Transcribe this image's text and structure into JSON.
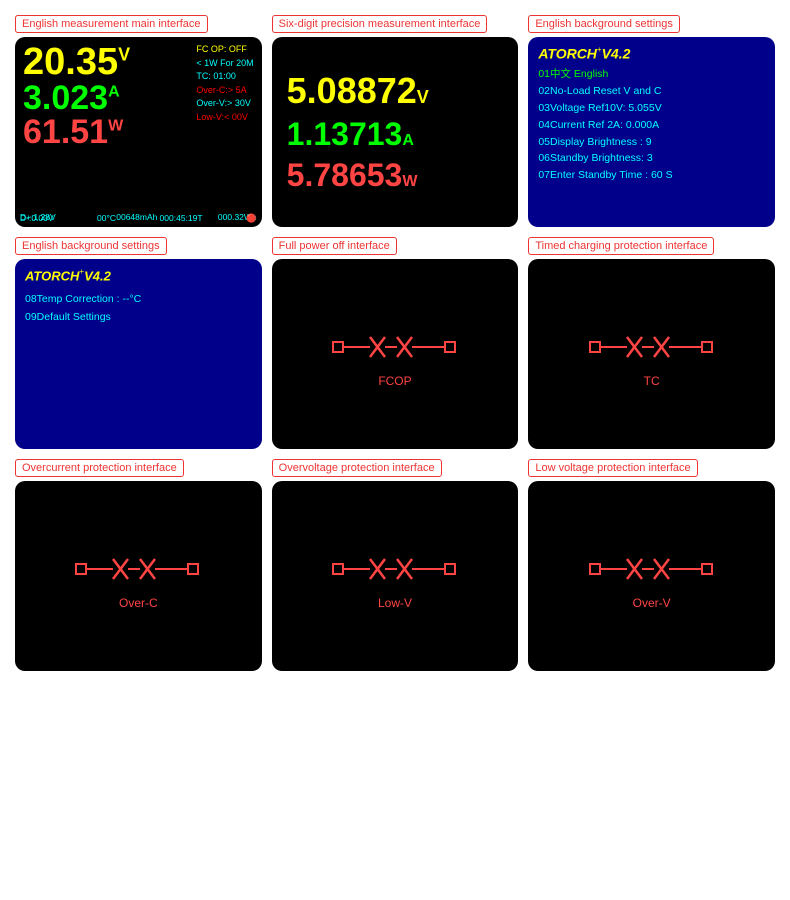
{
  "cells": [
    {
      "label": "English measurement main interface",
      "type": "main"
    },
    {
      "label": "Six-digit precision measurement interface",
      "type": "six"
    },
    {
      "label": "English background settings",
      "type": "bg1"
    },
    {
      "label": "English background settings",
      "type": "bg2"
    },
    {
      "label": "Full power off interface",
      "type": "fcop"
    },
    {
      "label": "Timed charging protection interface",
      "type": "tc"
    },
    {
      "label": "Overcurrent protection interface",
      "type": "overc"
    },
    {
      "label": "Overvoltage protection interface",
      "type": "lowv"
    },
    {
      "label": "Low voltage protection interface",
      "type": "overv"
    }
  ],
  "main": {
    "voltage": "20.35",
    "voltage_unit": "V",
    "current": "3.023",
    "current_unit": "A",
    "power": "61.51",
    "power_unit": "W",
    "fc": "FC OP: OFF",
    "lt1w": "< 1W For 20M",
    "tc": "TC:    01:00",
    "oc": "Over-C:> 5A",
    "ov": "Over-V:> 30V",
    "lv": "Low-V:< 00V",
    "d_pos": "D+:1.28V",
    "mah": "00648mAh",
    "wh": "000.32Wh",
    "d_neg": "D-:0.00V",
    "temp": "00°C",
    "time": "000:45:19T"
  },
  "six": {
    "voltage": "5.08872",
    "voltage_unit": "V",
    "current": "1.13713",
    "current_unit": "A",
    "power": "5.78653",
    "power_unit": "W"
  },
  "bg1": {
    "title": "ATORCH",
    "sup": "+",
    "version": "V4.2",
    "line01": "01中文  English",
    "line02": "02No-Load Reset V and C",
    "line03": "03Voltage  Ref10V: 5.055V",
    "line04": "04Current  Ref 2A: 0.000A",
    "line05": "05Display Brightness  :   9",
    "line06": "06Standby Brightness:    3",
    "line07": "07Enter Standby Time :   60 S"
  },
  "bg2": {
    "title": "ATORCH",
    "sup": "+",
    "version": "V4.2",
    "line08": "08Temp Correction     : --°C",
    "line09": "09Default Settings"
  },
  "labels": {
    "fcop": "FCOP",
    "tc": "TC",
    "overc": "Over-C",
    "lowv": "Low-V",
    "overv": "Over-V"
  }
}
